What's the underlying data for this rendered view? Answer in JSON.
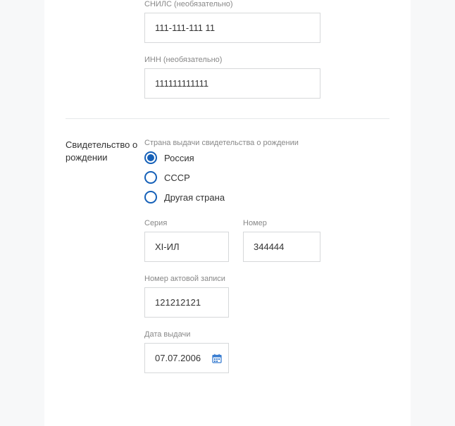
{
  "top": {
    "snils_label": "СНИЛС (необязательно)",
    "snils_value": "111-111-111 11",
    "inn_label": "ИНН (необязательно)",
    "inn_value": "111111111111"
  },
  "cert": {
    "section_title": "Свидетельство о рождении",
    "country_label": "Страна выдачи свидетельства о рождении",
    "country_options": {
      "russia": "Россия",
      "ussr": "СССР",
      "other": "Другая страна"
    },
    "series_label": "Серия",
    "series_value": "XI-ИЛ",
    "number_label": "Номер",
    "number_value": "344444",
    "record_label": "Номер актовой записи",
    "record_value": "121212121",
    "issue_date_label": "Дата выдачи",
    "issue_date_value": "07.07.2006"
  }
}
